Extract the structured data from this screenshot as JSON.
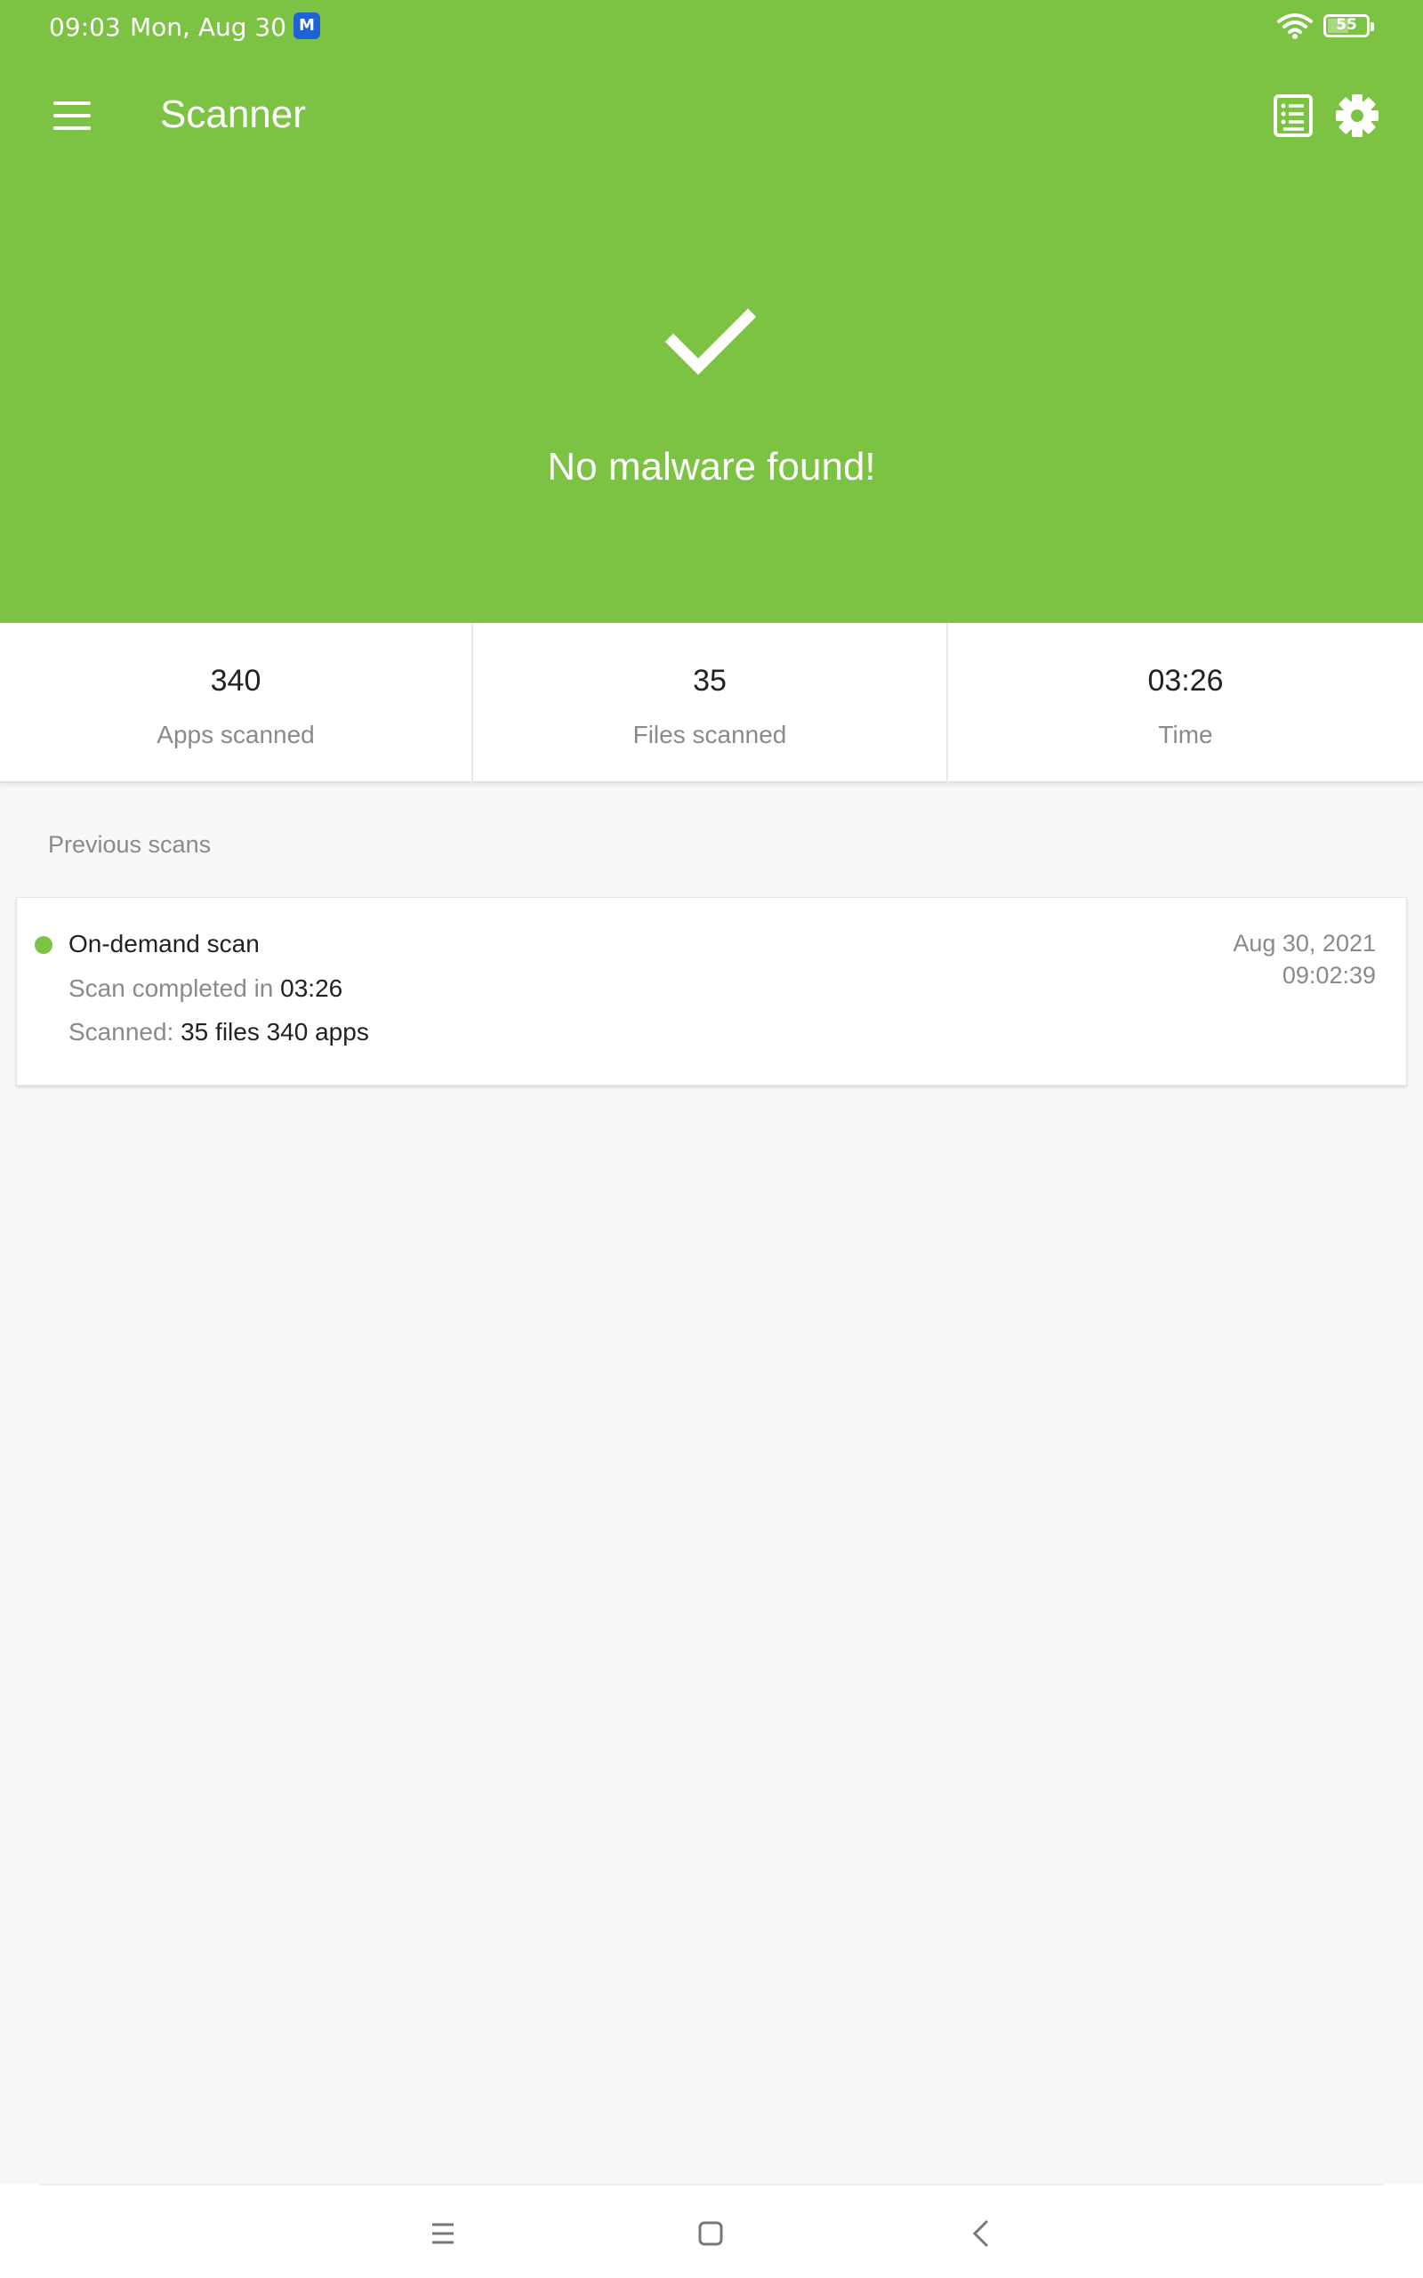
{
  "status_bar": {
    "time": "09:03",
    "date": "Mon, Aug 30",
    "app_icon": "M",
    "battery": "55",
    "battery_level": 55
  },
  "app_bar": {
    "title": "Scanner",
    "icons": [
      "menu-icon",
      "history-icon",
      "settings-icon"
    ]
  },
  "result": {
    "icon": "checkmark-icon",
    "text": "No malware found!"
  },
  "stats": [
    {
      "value": "340",
      "label": "Apps scanned"
    },
    {
      "value": "35",
      "label": "Files scanned"
    },
    {
      "value": "03:26",
      "label": "Time"
    }
  ],
  "previous_scans": {
    "title": "Previous scans",
    "items": [
      {
        "name": "On-demand scan",
        "completed_prefix": "Scan completed in",
        "completed_value": "03:26",
        "scanned_prefix": "Scanned:",
        "scanned_value": "35 files 340 apps",
        "date": "Aug 30, 2021",
        "time": "09:02:39"
      }
    ]
  },
  "colors": {
    "accent": "#7cc243",
    "background": "#f8f8f8"
  }
}
